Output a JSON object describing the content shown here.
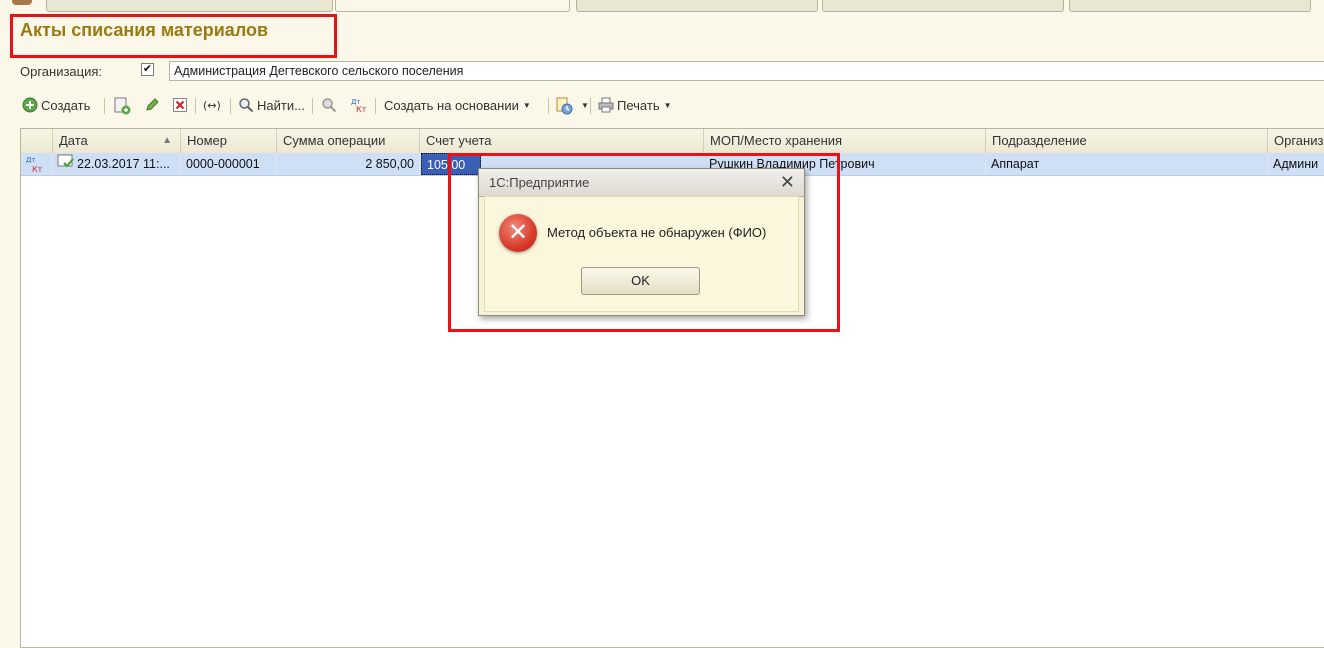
{
  "page": {
    "title": "Акты списания материалов"
  },
  "filter": {
    "org_label": "Организация:",
    "org_checked": "✔",
    "org_value": "Администрация Дегтевского сельского поселения"
  },
  "toolbar": {
    "create": "Создать",
    "find": "Найти...",
    "create_based": "Создать на основании",
    "print": "Печать"
  },
  "table": {
    "columns": [
      "Дата",
      "Номер",
      "Сумма операции",
      "Счет учета",
      "МОП/Место хранения",
      "Подразделение",
      "Организ"
    ],
    "row": {
      "date": "22.03.2017 11:...",
      "number": "0000-000001",
      "sum": "2 850,00",
      "account": "105.00",
      "mop": "Рушкин Владимир Петрович",
      "department": "Аппарат",
      "organization": "Админи"
    }
  },
  "dialog": {
    "title": "1С:Предприятие",
    "message": "Метод объекта не обнаружен (ФИО)",
    "ok": "OK"
  },
  "colors": {
    "title": "#9a7a10",
    "highlight": "#ef0f17",
    "selection": "#cfe0f6",
    "error_icon": "#d83a2a"
  }
}
